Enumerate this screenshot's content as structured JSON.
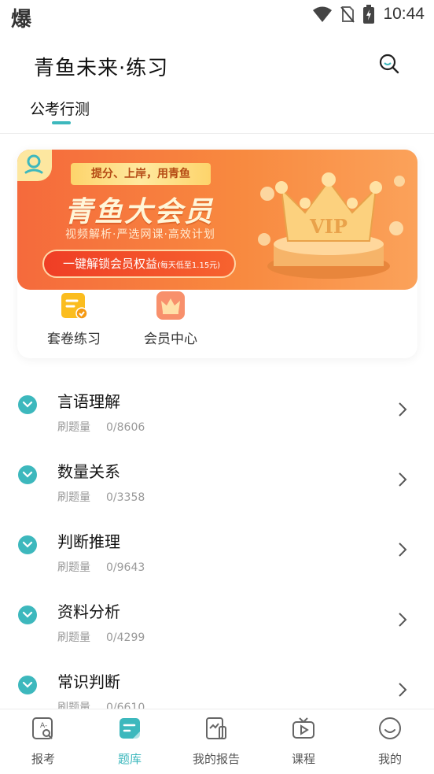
{
  "status_bar": {
    "left_glyph": "爆",
    "time": "10:44"
  },
  "header": {
    "title": "青鱼未来·练习"
  },
  "tabs": [
    {
      "label": "公考行测",
      "active": true
    }
  ],
  "banner": {
    "ribbon": "提分、上岸，用青鱼",
    "title": "青鱼大会员",
    "subtitle": "视频解析·严选网课·高效计划",
    "cta_main": "一键解锁会员权益",
    "cta_note": "(每天低至1.15元)",
    "badge_text": "VIP"
  },
  "shortcuts": [
    {
      "label": "套卷练习",
      "icon": "exam-paper-icon"
    },
    {
      "label": "会员中心",
      "icon": "crown-icon"
    }
  ],
  "subjects": [
    {
      "name": "言语理解",
      "meta_label": "刷题量",
      "count": "0/8606"
    },
    {
      "name": "数量关系",
      "meta_label": "刷题量",
      "count": "0/3358"
    },
    {
      "name": "判断推理",
      "meta_label": "刷题量",
      "count": "0/9643"
    },
    {
      "name": "资料分析",
      "meta_label": "刷题量",
      "count": "0/4299"
    },
    {
      "name": "常识判断",
      "meta_label": "刷题量",
      "count": "0/6610"
    }
  ],
  "bottom_nav": [
    {
      "label": "报考",
      "icon": "exam-register-icon",
      "active": false
    },
    {
      "label": "题库",
      "icon": "question-bank-icon",
      "active": true
    },
    {
      "label": "我的报告",
      "icon": "report-icon",
      "active": false
    },
    {
      "label": "课程",
      "icon": "video-course-icon",
      "active": false
    },
    {
      "label": "我的",
      "icon": "profile-icon",
      "active": false
    }
  ],
  "colors": {
    "accent": "#3db8bd",
    "banner_start": "#f56a3c",
    "banner_end": "#fba25a"
  }
}
